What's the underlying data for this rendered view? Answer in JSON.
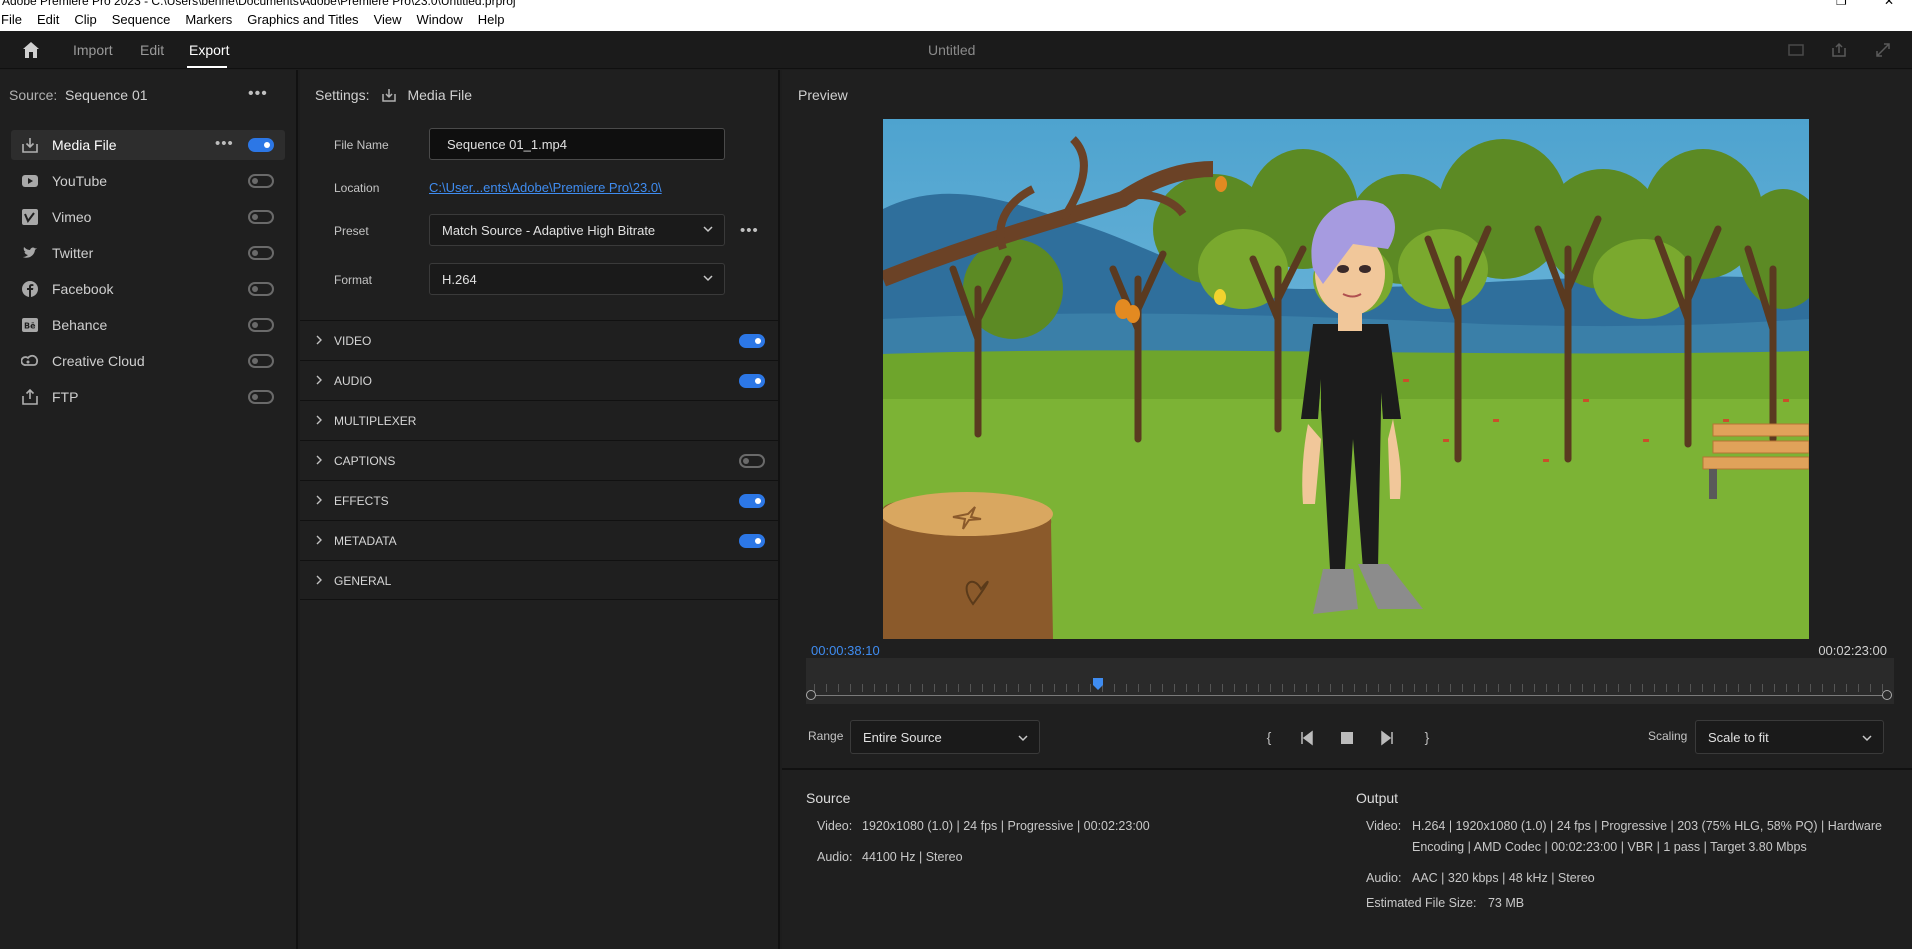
{
  "window": {
    "title": "Adobe Premiere Pro 2023 - C:\\Users\\benne\\Documents\\Adobe\\Premiere Pro\\23.0\\Untitled.prproj"
  },
  "menu": [
    "File",
    "Edit",
    "Clip",
    "Sequence",
    "Markers",
    "Graphics and Titles",
    "View",
    "Window",
    "Help"
  ],
  "appbar": {
    "import": "Import",
    "edit": "Edit",
    "export": "Export",
    "document": "Untitled"
  },
  "source": {
    "label": "Source:",
    "name": "Sequence 01"
  },
  "destinations": [
    {
      "label": "Media File",
      "icon": "media-file-icon",
      "on": true,
      "selected": true
    },
    {
      "label": "YouTube",
      "icon": "youtube-icon",
      "on": false
    },
    {
      "label": "Vimeo",
      "icon": "vimeo-icon",
      "on": false
    },
    {
      "label": "Twitter",
      "icon": "twitter-icon",
      "on": false
    },
    {
      "label": "Facebook",
      "icon": "facebook-icon",
      "on": false
    },
    {
      "label": "Behance",
      "icon": "behance-icon",
      "on": false
    },
    {
      "label": "Creative Cloud",
      "icon": "creative-cloud-icon",
      "on": false
    },
    {
      "label": "FTP",
      "icon": "ftp-icon",
      "on": false
    }
  ],
  "settings": {
    "label": "Settings:",
    "target": "Media File",
    "file_name_label": "File Name",
    "file_name": "Sequence 01_1.mp4",
    "location_label": "Location",
    "location": "C:\\User...ents\\Adobe\\Premiere Pro\\23.0\\",
    "preset_label": "Preset",
    "preset": "Match Source - Adaptive High Bitrate",
    "format_label": "Format",
    "format": "H.264",
    "sections": [
      {
        "label": "VIDEO",
        "toggle": true,
        "on": true
      },
      {
        "label": "AUDIO",
        "toggle": true,
        "on": true
      },
      {
        "label": "MULTIPLEXER",
        "toggle": false
      },
      {
        "label": "CAPTIONS",
        "toggle": true,
        "on": false
      },
      {
        "label": "EFFECTS",
        "toggle": true,
        "on": true
      },
      {
        "label": "METADATA",
        "toggle": true,
        "on": true
      },
      {
        "label": "GENERAL",
        "toggle": false
      }
    ]
  },
  "preview": {
    "label": "Preview",
    "current_time": "00:00:38:10",
    "end_time": "00:02:23:00",
    "playhead_fraction": 0.2667,
    "range_label": "Range",
    "range_value": "Entire Source",
    "scaling_label": "Scaling",
    "scaling_value": "Scale to fit"
  },
  "source_info": {
    "heading": "Source",
    "video_label": "Video:",
    "video": "1920x1080 (1.0)  |  24 fps  |  Progressive  |  00:02:23:00",
    "audio_label": "Audio:",
    "audio": "44100 Hz  |  Stereo"
  },
  "output_info": {
    "heading": "Output",
    "video_label": "Video:",
    "video_line1": "H.264  |  1920x1080 (1.0)  |  24 fps  |  Progressive  |  203 (75% HLG, 58% PQ)  |  Hardware",
    "video_line2": "Encoding  |  AMD Codec  |  00:02:23:00   |  VBR  |  1 pass  |  Target 3.80 Mbps",
    "audio_label": "Audio:",
    "audio": "AAC  |  320 kbps  |  48 kHz  |  Stereo",
    "size_label": "Estimated File Size:",
    "size": "73 MB"
  },
  "colors": {
    "accent": "#2c77e6",
    "link": "#3f8cf0",
    "panel": "#1f1f1f"
  }
}
